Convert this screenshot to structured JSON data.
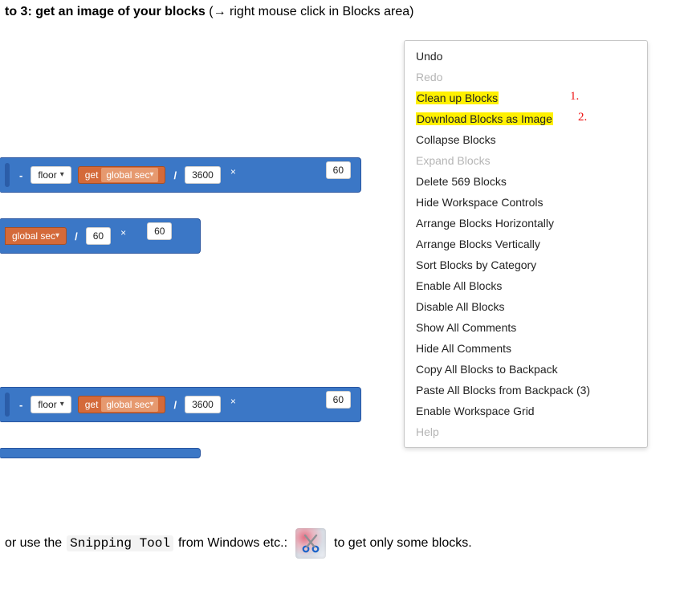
{
  "headline": {
    "bold": "to 3: get an image of your blocks",
    "light": " (→ right mouse click in Blocks area)"
  },
  "blocks": {
    "row1": {
      "floor_label": "floor",
      "get_label": "get",
      "var_label": "global sec",
      "divisor": "3600",
      "right_val": "60"
    },
    "row2": {
      "var_label": "global sec",
      "divisor": "60",
      "right_val": "60"
    },
    "row3": {
      "floor_label": "floor",
      "get_label": "get",
      "var_label": "global sec",
      "divisor": "3600",
      "right_val": "60"
    }
  },
  "menu": {
    "items": [
      {
        "label": "Undo",
        "disabled": false,
        "highlight": false
      },
      {
        "label": "Redo",
        "disabled": true,
        "highlight": false
      },
      {
        "label": "Clean up Blocks",
        "disabled": false,
        "highlight": true,
        "annot": "1."
      },
      {
        "label": "Download Blocks as Image",
        "disabled": false,
        "highlight": true,
        "annot": "2."
      },
      {
        "label": "Collapse Blocks",
        "disabled": false,
        "highlight": false
      },
      {
        "label": "Expand Blocks",
        "disabled": true,
        "highlight": false
      },
      {
        "label": "Delete 569 Blocks",
        "disabled": false,
        "highlight": false
      },
      {
        "label": "Hide Workspace Controls",
        "disabled": false,
        "highlight": false
      },
      {
        "label": "Arrange Blocks Horizontally",
        "disabled": false,
        "highlight": false
      },
      {
        "label": "Arrange Blocks Vertically",
        "disabled": false,
        "highlight": false
      },
      {
        "label": "Sort Blocks by Category",
        "disabled": false,
        "highlight": false
      },
      {
        "label": "Enable All Blocks",
        "disabled": false,
        "highlight": false
      },
      {
        "label": "Disable All Blocks",
        "disabled": false,
        "highlight": false
      },
      {
        "label": "Show All Comments",
        "disabled": false,
        "highlight": false
      },
      {
        "label": "Hide All Comments",
        "disabled": false,
        "highlight": false
      },
      {
        "label": "Copy All Blocks to Backpack",
        "disabled": false,
        "highlight": false
      },
      {
        "label": "Paste All Blocks from Backpack (3)",
        "disabled": false,
        "highlight": false
      },
      {
        "label": "Enable Workspace Grid",
        "disabled": false,
        "highlight": false
      },
      {
        "label": "Help",
        "disabled": true,
        "highlight": false
      }
    ]
  },
  "footer": {
    "prefix": "or use the ",
    "tool_name": "Snipping Tool",
    "middle": " from Windows etc.: ",
    "suffix": " to get only some blocks."
  }
}
